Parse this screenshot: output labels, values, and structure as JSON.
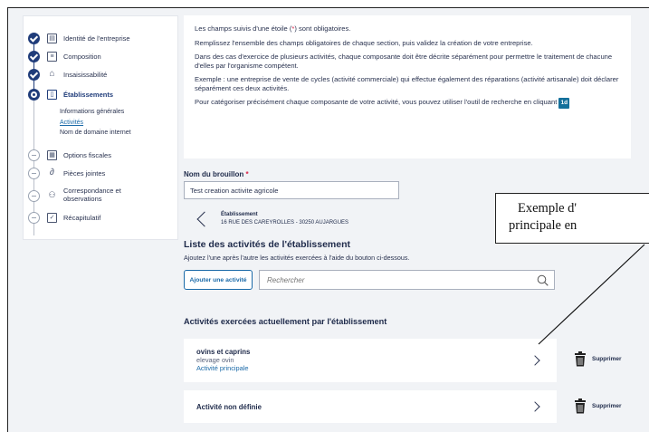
{
  "sidebar": {
    "steps": [
      {
        "label": "Identité de l'entreprise",
        "state": "done",
        "icon": "id-card-icon"
      },
      {
        "label": "Composition",
        "state": "done",
        "icon": "document-list-icon"
      },
      {
        "label": "Insaisissabilité",
        "state": "done",
        "icon": "house-icon"
      },
      {
        "label": "Établissements",
        "state": "active",
        "icon": "building-icon"
      },
      {
        "label": "Options fiscales",
        "state": "todo",
        "icon": "grid-icon"
      },
      {
        "label": "Pièces jointes",
        "state": "todo",
        "icon": "paperclip-icon"
      },
      {
        "label": "Correspondance et observations",
        "state": "todo",
        "icon": "people-icon"
      },
      {
        "label": "Récapitulatif",
        "state": "todo",
        "icon": "checklist-icon"
      }
    ],
    "sub_items": [
      "Informations générales",
      "Activités",
      "Nom de domaine internet"
    ]
  },
  "info": {
    "p1_before": "Les champs suivis d'une étoile (",
    "p1_star": "*",
    "p1_after": ") sont obligatoires.",
    "p2": "Remplissez l'ensemble des champs obligatoires de chaque section, puis validez la création de votre entreprise.",
    "p3": "Dans des cas d'exercice de plusieurs activités, chaque composante doit être décrite séparément pour permettre le traitement de chacune d'elles par l'organisme compétent.",
    "p4": "Exemple : une entreprise de vente de cycles (activité commerciale) qui effectue également des réparations (activité artisanale) doit déclarer séparément ces deux activités.",
    "p5": "Pour catégoriser précisément chaque composante de votre activité, vous pouvez utiliser l'outil de recherche en cliquant",
    "tag": "1d"
  },
  "draft": {
    "label": "Nom du brouillon",
    "star": "*",
    "value": "Test creation activite agricole"
  },
  "establishment": {
    "title": "Établissement",
    "address": "16 RUE DES CAREYROLLES - 30250 AUJARGUES"
  },
  "activities": {
    "title": "Liste des activités de l'établissement",
    "subtitle": "Ajoutez l'une après l'autre les activités exercées à l'aide du bouton ci-dessous.",
    "add_button": "Ajouter une activité",
    "search_placeholder": "Rechercher",
    "current_title": "Activités exercées actuellement par l'établissement",
    "items": [
      {
        "title": "ovins et caprins",
        "subtitle": "elevage ovin",
        "tag": "Activité principale",
        "delete": "Supprimer"
      },
      {
        "title": "Activité non définie",
        "delete": "Supprimer"
      }
    ]
  },
  "callout": {
    "line1": "Exemple d'",
    "line2": "principale en"
  },
  "colors": {
    "primary": "#1f3c7a",
    "link": "#1b6aa8",
    "required": "#d9264a",
    "background": "#f1f3f6"
  }
}
